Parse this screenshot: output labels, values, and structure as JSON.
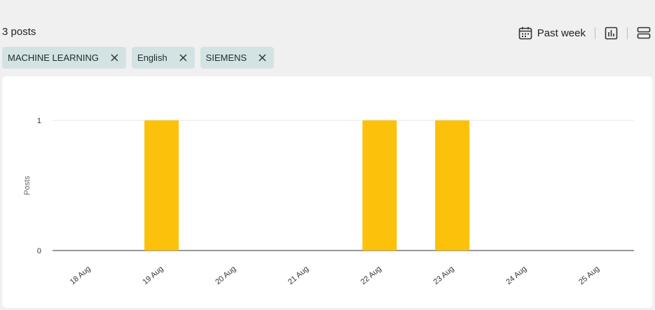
{
  "header": {
    "count": "3 posts"
  },
  "toolbar": {
    "period_label": "Past week",
    "icons": [
      "calendar-icon",
      "bar-chart-icon",
      "list-view-icon"
    ]
  },
  "filters": [
    {
      "label": "MACHINE LEARNING"
    },
    {
      "label": "English"
    },
    {
      "label": "SIEMENS"
    }
  ],
  "colors": {
    "bar": "#fcc10b",
    "chip": "#d3e3e3",
    "background": "#f0f0f0"
  },
  "chart_data": {
    "type": "bar",
    "categories": [
      "18 Aug",
      "19 Aug",
      "20 Aug",
      "21 Aug",
      "22 Aug",
      "23 Aug",
      "24 Aug",
      "25 Aug"
    ],
    "values": [
      0,
      1,
      0,
      0,
      1,
      1,
      0,
      0
    ],
    "ylabel": "Posts",
    "ylim": [
      0,
      1
    ],
    "yticks": [
      0,
      1
    ],
    "grid": true,
    "legend": "none"
  }
}
